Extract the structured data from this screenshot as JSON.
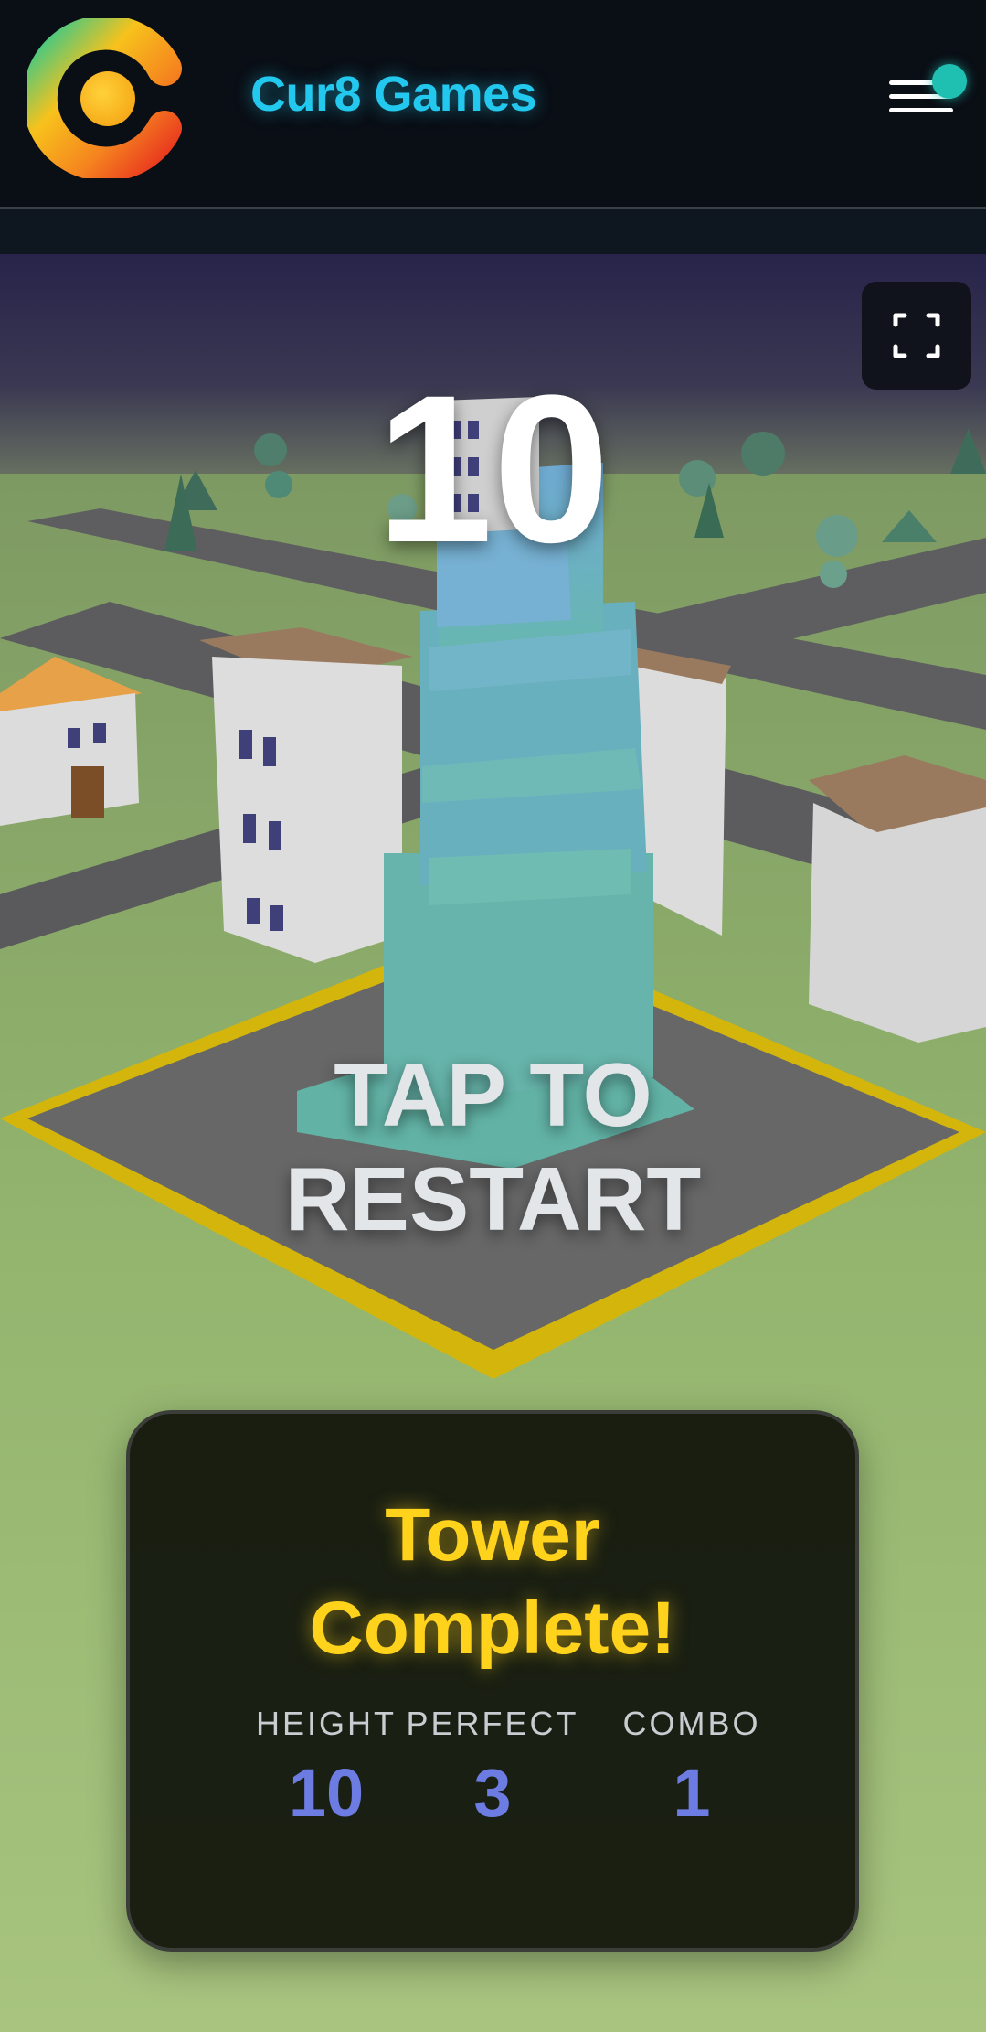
{
  "header": {
    "brand": "Cur8 Games"
  },
  "game": {
    "score": "10",
    "tap_line1": "TAP TO",
    "tap_line2": "RESTART"
  },
  "result_card": {
    "title_line1": "Tower",
    "title_line2": "Complete!",
    "stats": [
      {
        "label": "HEIGHT",
        "value": "10"
      },
      {
        "label": "PERFECT",
        "value": "3"
      },
      {
        "label": "COMBO",
        "value": "1"
      }
    ]
  },
  "icons": {
    "logo": "cur8-logo-icon",
    "menu": "hamburger-menu-icon",
    "notification": "notification-dot-icon",
    "fullscreen": "fullscreen-icon"
  },
  "colors": {
    "brand": "#23c8ee",
    "title": "#ffd21c",
    "stat_value": "#6c7ce2",
    "tower": "#6ab8b0",
    "platform_border": "#d4b50c"
  }
}
